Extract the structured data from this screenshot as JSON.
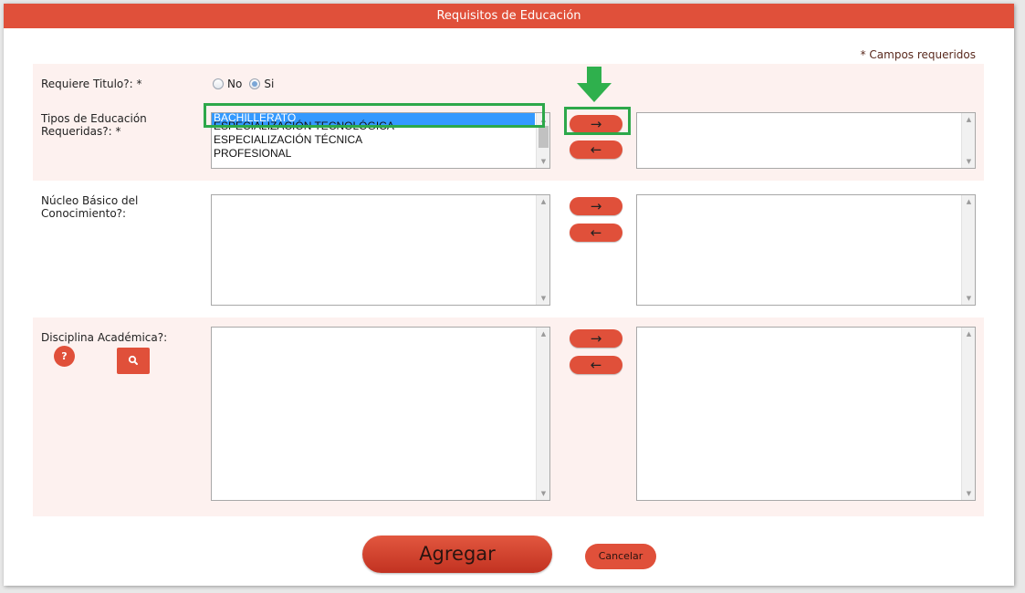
{
  "dialog": {
    "title": "Requisitos de Educación",
    "required_note": "* Campos requeridos"
  },
  "requiere_titulo": {
    "label": "Requiere Titulo?: *",
    "options": [
      "No",
      "Si"
    ],
    "selected": "Si"
  },
  "tipos_educacion": {
    "label_line1": "Tipos de Educación",
    "label_line2": "Requeridas?: *",
    "available": [
      "BACHILLERATO",
      "ESPECIALIZACIÓN TECNOLÓGICA",
      "ESPECIALIZACIÓN TÉCNICA",
      "PROFESIONAL"
    ],
    "selected_option": "BACHILLERATO",
    "chosen": []
  },
  "nucleo_basico": {
    "label_line1": "Núcleo Básico del",
    "label_line2": "Conocimiento?:",
    "available": [],
    "chosen": []
  },
  "disciplina": {
    "label": "Disciplina Académica?:",
    "help_icon": "?",
    "search_icon": "search-icon",
    "available": [],
    "chosen": []
  },
  "buttons": {
    "move_right": "→",
    "move_left": "←",
    "agregar": "Agregar",
    "cancelar": "Cancelar"
  },
  "colors": {
    "accent": "#e0503a",
    "highlight": "#2da84a",
    "selection": "#3399ff"
  }
}
